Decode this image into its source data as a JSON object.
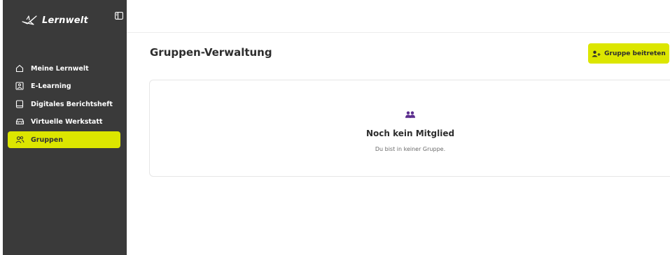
{
  "brand": {
    "name": "Lernwelt",
    "icon": "bird-logo-icon"
  },
  "sidebar": {
    "toggle_icon": "sidebar-toggle-icon",
    "items": [
      {
        "label": "Meine Lernwelt",
        "icon": "home-icon",
        "active": false
      },
      {
        "label": "E-Learning",
        "icon": "elearning-icon",
        "active": false
      },
      {
        "label": "Digitales Berichtsheft",
        "icon": "book-icon",
        "active": false
      },
      {
        "label": "Virtuelle Werkstatt",
        "icon": "car-icon",
        "active": false
      },
      {
        "label": "Gruppen",
        "icon": "users-icon",
        "active": true
      }
    ]
  },
  "main": {
    "title": "Gruppen-Verwaltung",
    "join_button": {
      "label": "Gruppe beitreten",
      "icon": "user-plus-icon"
    },
    "empty_state": {
      "icon": "group-icon",
      "title": "Noch kein Mitglied",
      "subtitle": "Du bist in keiner Gruppe."
    }
  },
  "colors": {
    "sidebar_bg": "#3a3a3a",
    "accent": "#dce600",
    "icon_purple": "#5b2d8e",
    "text_dark": "#2d2d2d"
  }
}
